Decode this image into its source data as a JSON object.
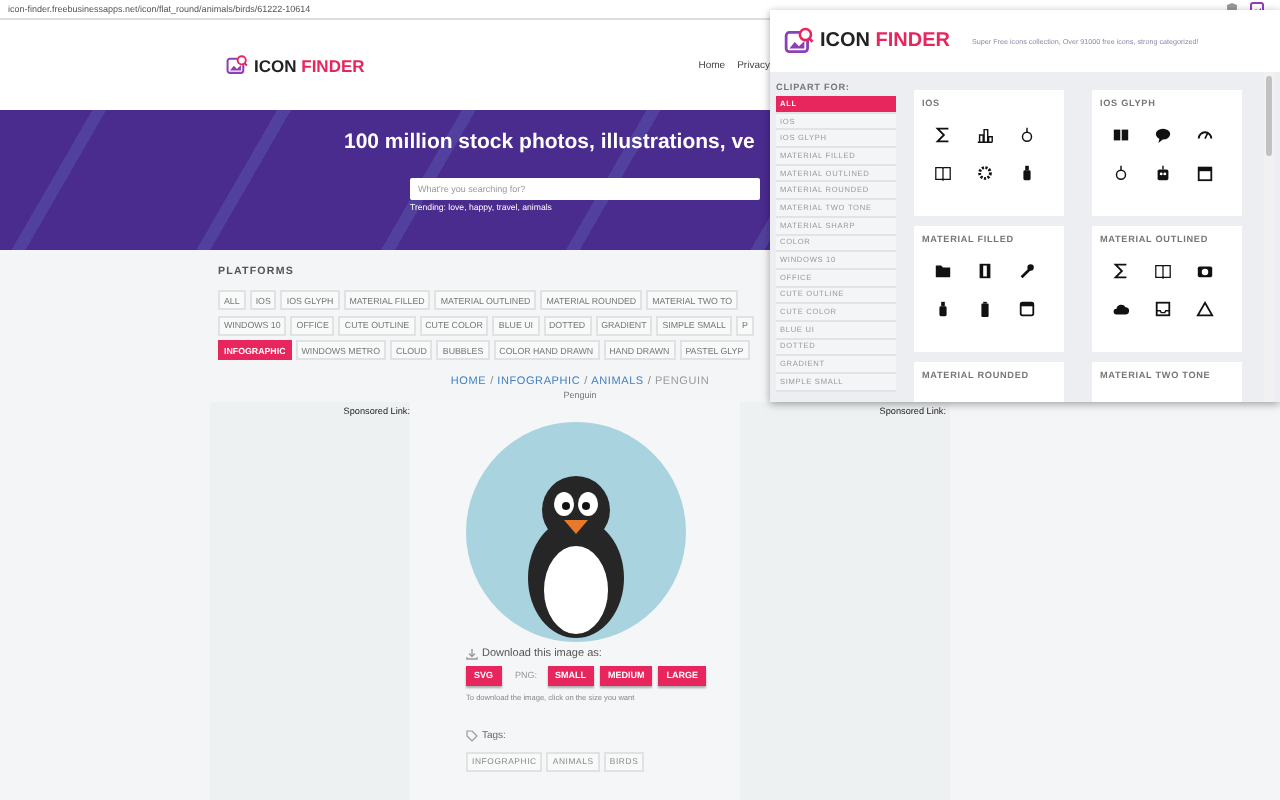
{
  "address_bar": {
    "url": "icon-finder.freebusinessapps.net/icon/flat_round/animals/birds/61222-10614"
  },
  "header": {
    "logo": {
      "word_1": "ICON",
      "word_2": "FINDER"
    },
    "nav": [
      "Home",
      "Privacy"
    ]
  },
  "banner": {
    "headline": "100 million stock photos, illustrations, ve",
    "search": {
      "placeholder": "What're you searching for?"
    },
    "trending": "Trending: love, happy, travel, animals"
  },
  "platforms": {
    "title": "PLATFORMS",
    "rows": [
      {
        "chips": [
          {
            "label": "ALL",
            "selected": false
          },
          {
            "label": "IOS",
            "selected": false
          },
          {
            "label": "IOS GLYPH",
            "selected": false
          },
          {
            "label": "MATERIAL FILLED",
            "selected": false
          },
          {
            "label": "MATERIAL OUTLINED",
            "selected": false
          },
          {
            "label": "MATERIAL ROUNDED",
            "selected": false
          },
          {
            "label": "MATERIAL TWO TO",
            "selected": false
          }
        ]
      },
      {
        "chips": [
          {
            "label": "WINDOWS 10",
            "selected": false
          },
          {
            "label": "OFFICE",
            "selected": false
          },
          {
            "label": "CUTE OUTLINE",
            "selected": false
          },
          {
            "label": "CUTE COLOR",
            "selected": false
          },
          {
            "label": "BLUE UI",
            "selected": false
          },
          {
            "label": "DOTTED",
            "selected": false
          },
          {
            "label": "GRADIENT",
            "selected": false
          },
          {
            "label": "SIMPLE SMALL",
            "selected": false
          },
          {
            "label": "P",
            "selected": false
          }
        ]
      },
      {
        "chips": [
          {
            "label": "INFOGRAPHIC",
            "selected": true
          },
          {
            "label": "WINDOWS METRO",
            "selected": false
          },
          {
            "label": "CLOUD",
            "selected": false
          },
          {
            "label": "BUBBLES",
            "selected": false
          },
          {
            "label": "COLOR HAND DRAWN",
            "selected": false
          },
          {
            "label": "HAND DRAWN",
            "selected": false
          },
          {
            "label": "PASTEL GLYP",
            "selected": false
          }
        ]
      }
    ]
  },
  "breadcrumb": {
    "separator": "/",
    "items": [
      {
        "label": "HOME",
        "link": true
      },
      {
        "label": "INFOGRAPHIC",
        "link": true
      },
      {
        "label": "ANIMALS",
        "link": true
      },
      {
        "label": "PENGUIN",
        "link": false
      }
    ]
  },
  "image_title": "Penguin",
  "ads": [
    "Sponsored Link:",
    "Sponsored Link:"
  ],
  "download": {
    "title": "Download this image as:",
    "svg_button": "SVG",
    "png_label": "PNG:",
    "png_buttons": [
      "SMALL",
      "MEDIUM",
      "LARGE"
    ],
    "hint": "To download the image, click on the size you want"
  },
  "tags": {
    "title": "Tags:",
    "items": [
      "INFOGRAPHIC",
      "ANIMALS",
      "BIRDS"
    ]
  },
  "popup": {
    "logo": {
      "word_1": "ICON",
      "word_2": "FINDER"
    },
    "tagline": "Super Free icons collection, Over 91000 free icons, strong categorized!",
    "sidebar": {
      "title": "CLIPART FOR:",
      "items": [
        {
          "label": "ALL",
          "selected": true
        },
        {
          "label": "IOS",
          "selected": false
        },
        {
          "label": "IOS GLYPH",
          "selected": false
        },
        {
          "label": "MATERIAL FILLED",
          "selected": false
        },
        {
          "label": "MATERIAL OUTLINED",
          "selected": false
        },
        {
          "label": "MATERIAL ROUNDED",
          "selected": false
        },
        {
          "label": "MATERIAL TWO TONE",
          "selected": false
        },
        {
          "label": "MATERIAL SHARP",
          "selected": false
        },
        {
          "label": "COLOR",
          "selected": false
        },
        {
          "label": "WINDOWS 10",
          "selected": false
        },
        {
          "label": "OFFICE",
          "selected": false
        },
        {
          "label": "CUTE OUTLINE",
          "selected": false
        },
        {
          "label": "CUTE COLOR",
          "selected": false
        },
        {
          "label": "BLUE UI",
          "selected": false
        },
        {
          "label": "DOTTED",
          "selected": false
        },
        {
          "label": "GRADIENT",
          "selected": false
        },
        {
          "label": "SIMPLE SMALL",
          "selected": false
        }
      ]
    },
    "cards": [
      {
        "title": "IOS"
      },
      {
        "title": "IOS GLYPH"
      },
      {
        "title": "MATERIAL FILLED"
      },
      {
        "title": "MATERIAL OUTLINED"
      },
      {
        "title": "MATERIAL ROUNDED"
      },
      {
        "title": "MATERIAL TWO TONE"
      }
    ]
  }
}
